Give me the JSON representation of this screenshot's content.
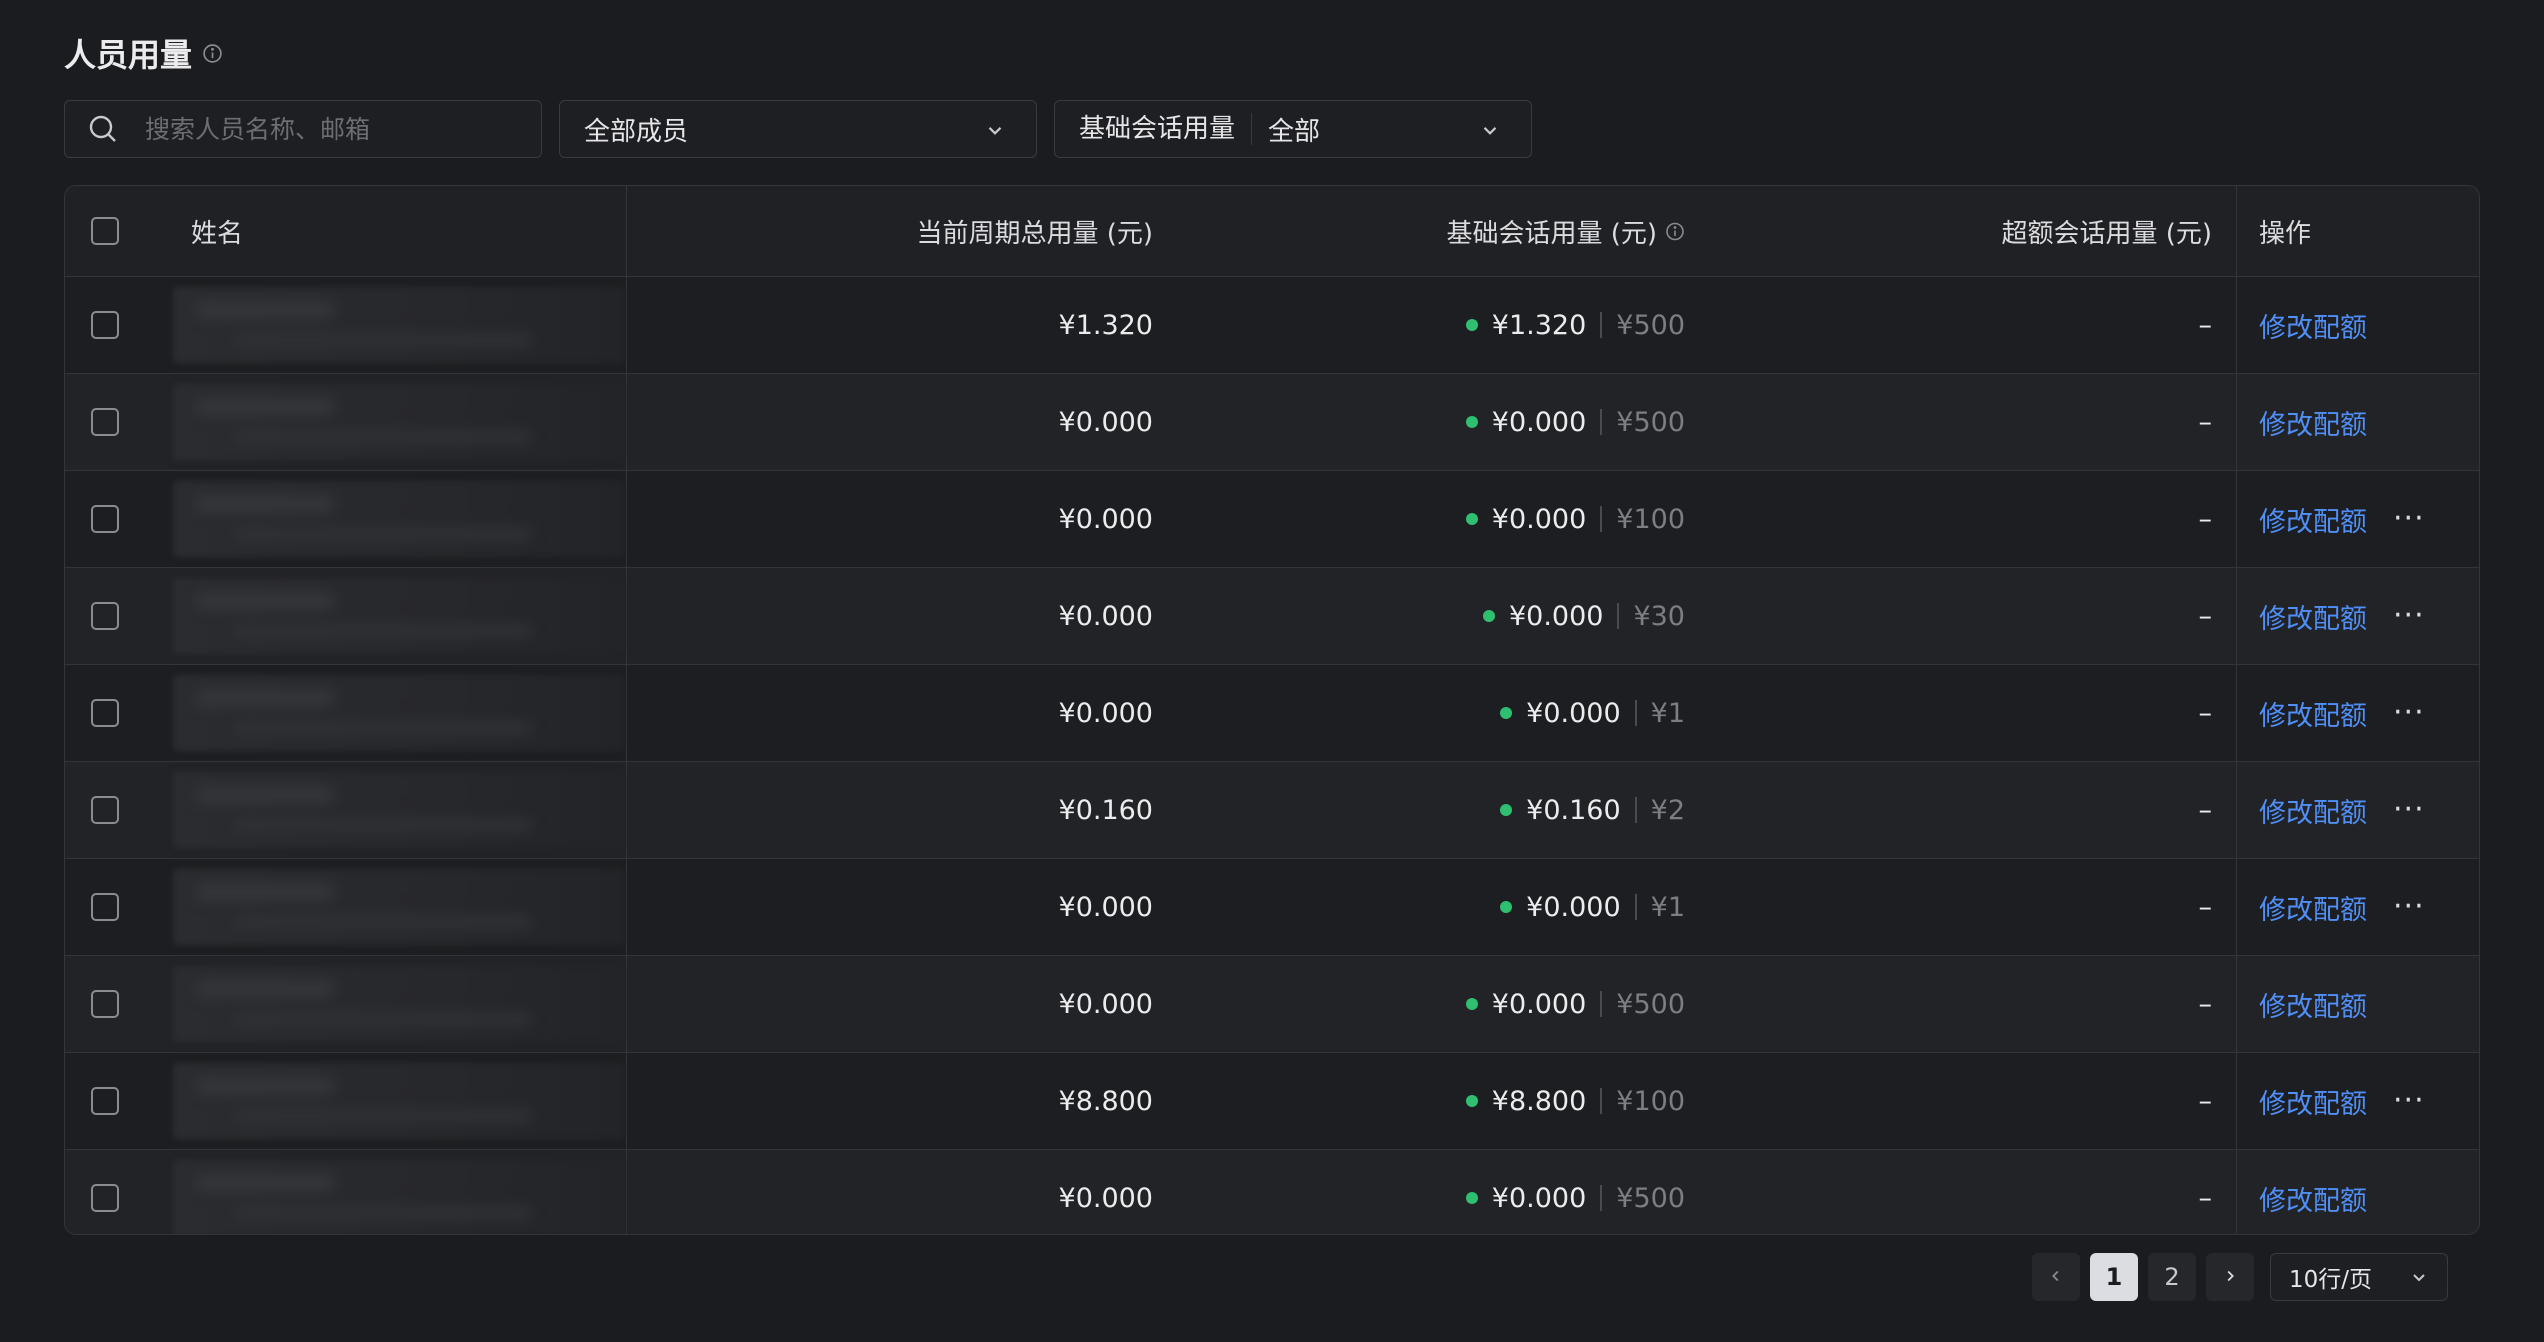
{
  "header": {
    "title": "人员用量"
  },
  "filters": {
    "search_placeholder": "搜索人员名称、邮箱",
    "member_select": "全部成员",
    "usage_label": "基础会话用量",
    "usage_select": "全部"
  },
  "table": {
    "columns": {
      "name": "姓名",
      "total": "当前周期总用量 (元)",
      "base": "基础会话用量 (元)",
      "over": "超额会话用量 (元)",
      "op": "操作"
    },
    "rows": [
      {
        "total": "¥1.320",
        "base_used": "¥1.320",
        "base_quota": "¥500",
        "over": "–",
        "op": "修改配额",
        "more": ""
      },
      {
        "total": "¥0.000",
        "base_used": "¥0.000",
        "base_quota": "¥500",
        "over": "–",
        "op": "修改配额",
        "more": ""
      },
      {
        "total": "¥0.000",
        "base_used": "¥0.000",
        "base_quota": "¥100",
        "over": "–",
        "op": "修改配额",
        "more": "···"
      },
      {
        "total": "¥0.000",
        "base_used": "¥0.000",
        "base_quota": "¥30",
        "over": "–",
        "op": "修改配额",
        "more": "···"
      },
      {
        "total": "¥0.000",
        "base_used": "¥0.000",
        "base_quota": "¥1",
        "over": "–",
        "op": "修改配额",
        "more": "···"
      },
      {
        "total": "¥0.160",
        "base_used": "¥0.160",
        "base_quota": "¥2",
        "over": "–",
        "op": "修改配额",
        "more": "···"
      },
      {
        "total": "¥0.000",
        "base_used": "¥0.000",
        "base_quota": "¥1",
        "over": "–",
        "op": "修改配额",
        "more": "···"
      },
      {
        "total": "¥0.000",
        "base_used": "¥0.000",
        "base_quota": "¥500",
        "over": "–",
        "op": "修改配额",
        "more": ""
      },
      {
        "total": "¥8.800",
        "base_used": "¥8.800",
        "base_quota": "¥100",
        "over": "–",
        "op": "修改配额",
        "more": "···"
      },
      {
        "total": "¥0.000",
        "base_used": "¥0.000",
        "base_quota": "¥500",
        "over": "–",
        "op": "修改配额",
        "more": ""
      }
    ]
  },
  "pagination": {
    "prev_icon": "chevron-left-icon",
    "pages": [
      "1",
      "2"
    ],
    "current": "1",
    "next_icon": "chevron-right-icon",
    "page_size": "10行/页"
  },
  "colors": {
    "accent": "#4f8ff7",
    "status_dot": "#2fbf71"
  }
}
